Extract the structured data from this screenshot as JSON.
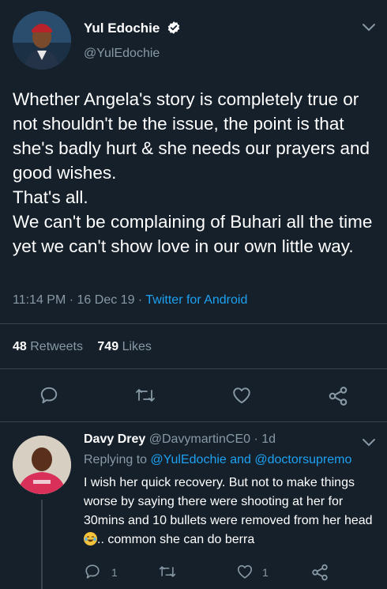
{
  "tweet": {
    "author_name": "Yul Edochie",
    "author_handle": "@YulEdochie",
    "text": "Whether Angela's story is completely true or not shouldn't be the issue, the point is that she's badly hurt & she needs our prayers and good wishes.\nThat's all.\nWe can't be complaining of Buhari all the time yet we can't show love in our own little way.",
    "time": "11:14 PM",
    "date": "16 Dec 19",
    "source": "Twitter for Android",
    "retweets_count": "48",
    "retweets_label": "Retweets",
    "likes_count": "749",
    "likes_label": "Likes"
  },
  "reply": {
    "author_name": "Davy Drey",
    "author_handle": "@DavymartinCE0",
    "age": "1d",
    "replying_prefix": "Replying to",
    "replying_to": "@YulEdochie and @doctorsupremo",
    "text_before_emoji": "I wish her quick recovery. But not to make things worse by saying there were shooting at her for 30mins and 10 bullets were removed from her head ",
    "text_after_emoji": ".. common she can do berra",
    "reply_count": "1",
    "like_count": "1"
  },
  "icons": {
    "verified": "verified-badge-icon",
    "chevron": "chevron-down-icon",
    "reply": "reply-icon",
    "retweet": "retweet-icon",
    "like": "heart-icon",
    "share": "share-icon",
    "emoji": "laughing-tears-emoji"
  },
  "colors": {
    "background": "#15202b",
    "text": "#ffffff",
    "muted": "#8899a6",
    "link": "#1da1f2",
    "divider": "#38444d"
  }
}
